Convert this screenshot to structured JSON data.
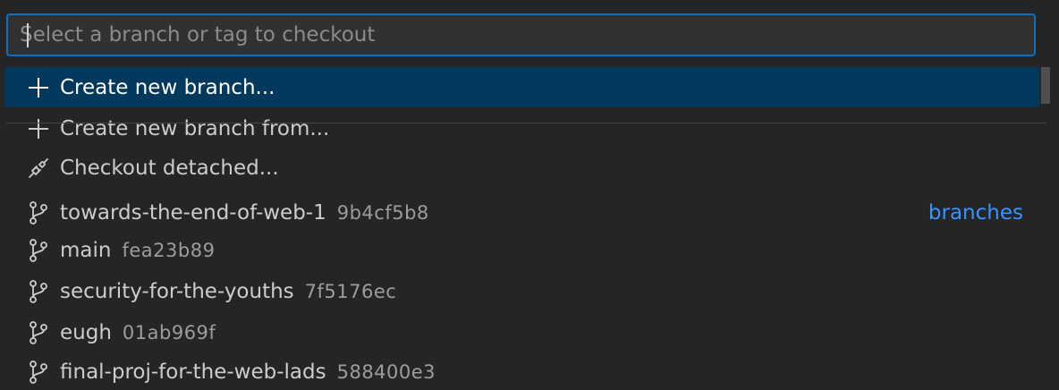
{
  "search": {
    "placeholder": "Select a branch or tag to checkout",
    "value": ""
  },
  "actions": [
    {
      "label": "Create new branch...",
      "icon": "plus-icon",
      "active": true
    },
    {
      "label": "Create new branch from...",
      "icon": "plus-icon",
      "active": false
    },
    {
      "label": "Checkout detached...",
      "icon": "debug-disconnect-icon",
      "active": false
    }
  ],
  "branches": [
    {
      "name": "towards-the-end-of-web-1",
      "hash": "9b4cf5b8",
      "group_label": "branches"
    },
    {
      "name": "main",
      "hash": "fea23b89"
    },
    {
      "name": "security-for-the-youths",
      "hash": "7f5176ec"
    },
    {
      "name": "eugh",
      "hash": "01ab969f"
    },
    {
      "name": "final-proj-for-the-web-lads",
      "hash": "588400e3"
    }
  ],
  "colors": {
    "background": "#252526",
    "active_row": "#04395e",
    "focus_border": "#0e70c0",
    "group_label": "#3794ff",
    "hash_text": "#9d9d9d"
  }
}
